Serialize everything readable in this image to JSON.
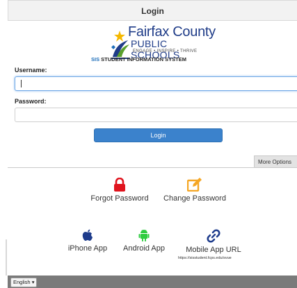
{
  "header": {
    "title": "Login"
  },
  "logo": {
    "name_line1": "Fairfax County",
    "name_line2": "PUBLIC SCHOOLS",
    "tagline": "ENGAGE • INSPIRE • THRIVE"
  },
  "system_title": {
    "abbr": "SIS",
    "rest": " STUDENT INFORMATION SYSTEM"
  },
  "form": {
    "username_label": "Username:",
    "username_value": "",
    "password_label": "Password:",
    "password_value": "",
    "login_label": "Login"
  },
  "more_options": {
    "label": "More Options"
  },
  "options": {
    "forgot_password": "Forgot Password",
    "change_password": "Change Password",
    "iphone_app": "iPhone App",
    "android_app": "Android App",
    "mobile_app_url": "Mobile App URL",
    "mobile_app_url_note": "https://sisstudent.fcps.edu/svue"
  },
  "footer": {
    "language": "English"
  },
  "icons": {
    "lock": "lock-icon",
    "edit": "edit-icon",
    "apple": "apple-icon",
    "android": "android-icon",
    "link": "link-icon"
  },
  "colors": {
    "accent": "#3b82cc",
    "lock": "#e0141e",
    "edit": "#f5a623",
    "android": "#2ecc40",
    "link": "#1e3c8c",
    "footer": "#7a7a7a"
  }
}
